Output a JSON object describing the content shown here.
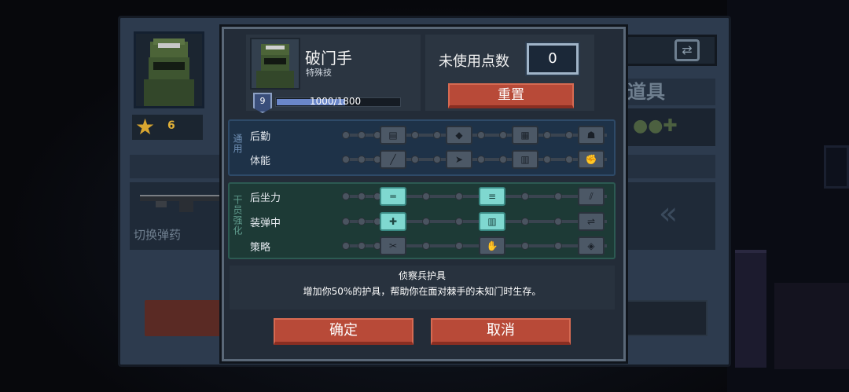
{
  "background": {
    "star_count": "6",
    "items_title": "道具",
    "swap_ammo_label": "切换弹药",
    "swap_icon": "swap-icon"
  },
  "dialog": {
    "character": {
      "name": "破门手",
      "subtitle": "特殊技",
      "level": "9",
      "xp_text": "1000/1800",
      "xp_progress": 0.556
    },
    "points": {
      "label": "未使用点数",
      "value": "0",
      "reset_label": "重置"
    },
    "groups": [
      {
        "label": "通用",
        "rows": [
          {
            "label": "后勤",
            "nodes": [
              {
                "icon": "ammo-belt-icon",
                "active": false
              },
              {
                "icon": "armor-plus-icon",
                "active": false
              },
              {
                "icon": "crate-icon",
                "active": false
              },
              {
                "icon": "team-icon",
                "active": false
              }
            ]
          },
          {
            "label": "体能",
            "nodes": [
              {
                "icon": "knife-icon",
                "active": false
              },
              {
                "icon": "sprint-icon",
                "active": false
              },
              {
                "icon": "vest-icon",
                "active": false
              },
              {
                "icon": "fist-icon",
                "active": false
              }
            ]
          }
        ]
      },
      {
        "label": "干员强化",
        "rows": [
          {
            "label": "后坐力",
            "nodes": [
              {
                "icon": "shotgun-icon",
                "active": true
              },
              {
                "icon": "shells-icon",
                "active": true
              },
              {
                "icon": "claw-icon",
                "active": false
              }
            ]
          },
          {
            "label": "装弹中",
            "nodes": [
              {
                "icon": "plus-shell-icon",
                "active": true
              },
              {
                "icon": "magazine-icon",
                "active": true
              },
              {
                "icon": "gun-reload-icon",
                "active": false
              }
            ]
          },
          {
            "label": "策略",
            "nodes": [
              {
                "icon": "tools-icon",
                "active": false
              },
              {
                "icon": "hand-icon",
                "active": false
              },
              {
                "icon": "shield-icon",
                "active": false
              }
            ]
          }
        ]
      }
    ],
    "description": {
      "title": "侦察兵护具",
      "text": "增加你50%的护具，帮助你在面对棘手的未知门时生存。"
    },
    "buttons": {
      "confirm": "确定",
      "cancel": "取消"
    }
  }
}
